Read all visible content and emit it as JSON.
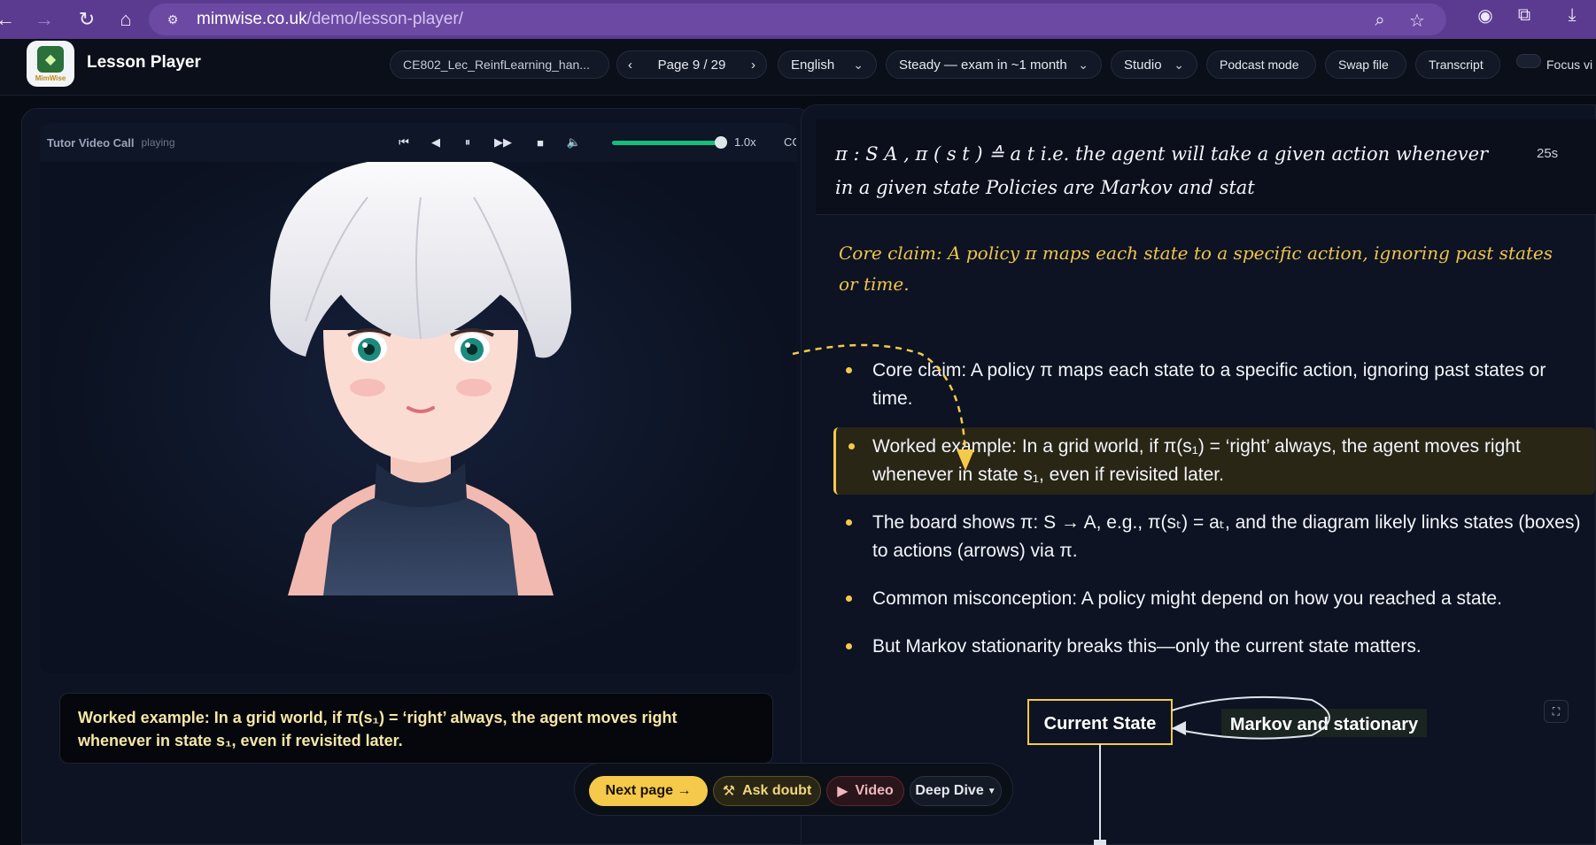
{
  "browser": {
    "url_host": "mimwise.co.uk",
    "url_path": "/demo/lesson-player/"
  },
  "header": {
    "logo_text": "MimWise",
    "title": "Lesson Player",
    "file_name": "CE802_Lec_ReinfLearning_han...",
    "page_indicator": "Page 9 / 29",
    "language": "English",
    "pace": "Steady — exam in ~1 month",
    "mode": "Studio",
    "podcast_label": "Podcast mode",
    "swap_label": "Swap file",
    "transcript_label": "Transcript",
    "focus_label": "Focus vi"
  },
  "video": {
    "label": "Tutor Video Call",
    "status": "playing",
    "volume": 1.0,
    "speed": "1.0x",
    "cc_label": "CC"
  },
  "caption": "Worked example: In a grid world, if π(s₁) = ‘right’ always, the agent moves right whenever in state s₁, even if revisited later.",
  "actions": {
    "next_label": "Next page →",
    "doubt_label": "Ask doubt",
    "video_label": "Video",
    "deep_label": "Deep Dive"
  },
  "board": {
    "formula": "π : S A , π ( s t ) ≙ a t i.e. the agent will take a given action whenever in a given state Policies are Markov and stat",
    "timer": "25s",
    "core_claim": "Core claim: A policy π maps each state to a specific action, ignoring past states or time.",
    "bullets": [
      "Core claim: A policy π maps each state to a specific action, ignoring past states or time.",
      "Worked example: In a grid world, if π(s₁) = ‘right’ always, the agent moves right whenever in state s₁, even if revisited later.",
      "The board shows π: S → A, e.g., π(sₜ) = aₜ, and the diagram likely links states (boxes) to actions (arrows) via π.",
      "Common misconception: A policy might depend on how you reached a state.",
      "But Markov stationarity breaks this—only the current state matters."
    ],
    "active_bullet": 1,
    "diagram": {
      "node_current": "Current State",
      "node_markov": "Markov and stationary"
    }
  },
  "colors": {
    "accent": "#f5c94a",
    "browser": "#5b3b8f",
    "volume": "#12c07a"
  }
}
